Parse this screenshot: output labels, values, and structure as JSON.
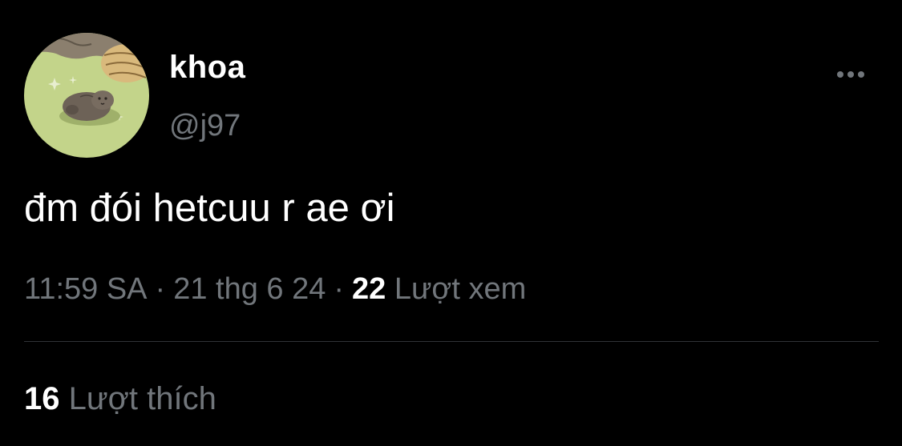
{
  "user": {
    "display_name": "khoa",
    "handle": "@j97",
    "avatar_icon": "animal-avatar-icon"
  },
  "tweet": {
    "text": "đm đói hetcuu r ae ơi"
  },
  "meta": {
    "time": "11:59 SA",
    "separator": "·",
    "date": "21 thg 6 24",
    "views_count": "22",
    "views_label": "Lượt xem"
  },
  "stats": {
    "likes_count": "16",
    "likes_label": "Lượt thích"
  },
  "more_icon": "more-dots-icon",
  "colors": {
    "background": "#000000",
    "primary_text": "#ffffff",
    "secondary_text": "#71767b",
    "divider": "#2f3336"
  }
}
